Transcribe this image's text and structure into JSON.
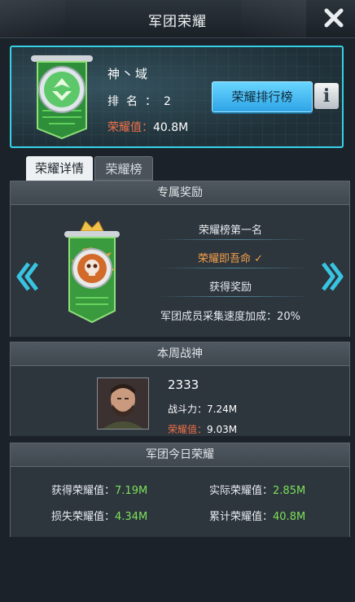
{
  "header": {
    "title": "军团荣耀"
  },
  "profile": {
    "name": "神丶域",
    "rank_label": "排名：",
    "rank_value": "2",
    "honor_label": "荣耀值：",
    "honor_value": "40.8M",
    "rank_button": "荣耀排行榜",
    "info_button": "i"
  },
  "tabs": [
    {
      "label": "荣耀详情",
      "active": true
    },
    {
      "label": "荣耀榜",
      "active": false
    }
  ],
  "exclusive_reward": {
    "title": "专属奖励",
    "line1": "荣耀榜第一名",
    "line2": "荣耀即吾命",
    "line2_check": "✓",
    "line3": "获得奖励",
    "line4": "军团成员采集速度加成：20%"
  },
  "weekly_warrior": {
    "title": "本周战神",
    "name": "2333",
    "power_label": "战斗力：",
    "power_value": "7.24M",
    "honor_label": "荣耀值：",
    "honor_value": "9.03M"
  },
  "today_honor": {
    "title": "军团今日荣耀",
    "gained_label": "获得荣耀值：",
    "gained_value": "7.19M",
    "actual_label": "实际荣耀值：",
    "actual_value": "2.85M",
    "lost_label": "损失荣耀值：",
    "lost_value": "4.34M",
    "total_label": "累计荣耀值：",
    "total_value": "40.8M"
  },
  "colors": {
    "accent_cyan": "#34d0e6",
    "honor_red": "#f07048",
    "value_green": "#7de05a",
    "orange_text": "#f2a04a"
  }
}
